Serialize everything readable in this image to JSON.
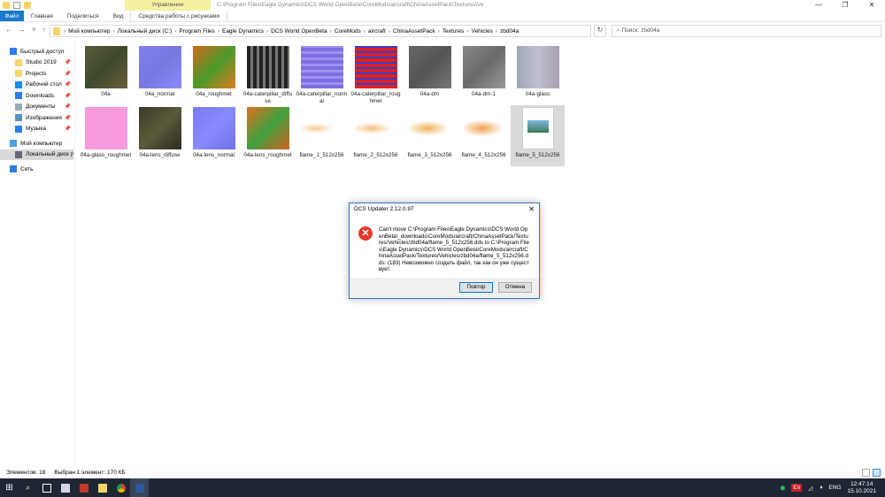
{
  "window": {
    "title": "C:\\Program Files\\Eagle Dynamics\\DCS World OpenBeta\\CoreMods\\aircraft\\ChinaAssetPack\\Textures\\Ve",
    "manage_tab": "Управление",
    "controls": [
      "—",
      "❐",
      "✕"
    ]
  },
  "ribbon": {
    "tabs": [
      "Файл",
      "Главная",
      "Поделиться",
      "Вид"
    ],
    "context_tab": "Средства работы с рисунками"
  },
  "address": {
    "crumbs": [
      "Мой компьютер",
      "Локальный диск (C:)",
      "Program Files",
      "Eagle Dynamics",
      "DCS World OpenBeta",
      "CoreMods",
      "aircraft",
      "ChinaAssetPack",
      "Textures",
      "Vehicles",
      "zbd04a"
    ],
    "search_placeholder": "Поиск: zbd04a"
  },
  "sidebar": {
    "items": [
      {
        "label": "Быстрый доступ",
        "icon": "star-icon",
        "color": "#2b7de9",
        "pin": false,
        "indent": 0
      },
      {
        "label": "Studio 2019",
        "icon": "folder-icon",
        "color": "#f6d36b",
        "pin": true,
        "indent": 1
      },
      {
        "label": "Projects",
        "icon": "folder-icon",
        "color": "#f6d36b",
        "pin": true,
        "indent": 1
      },
      {
        "label": "Рабочий стол",
        "icon": "desktop-icon",
        "color": "#1e88e5",
        "pin": true,
        "indent": 1
      },
      {
        "label": "Downloads",
        "icon": "download-icon",
        "color": "#2b7de9",
        "pin": true,
        "indent": 1
      },
      {
        "label": "Документы",
        "icon": "documents-icon",
        "color": "#9ab",
        "pin": true,
        "indent": 1
      },
      {
        "label": "Изображения",
        "icon": "pictures-icon",
        "color": "#5a8fc0",
        "pin": true,
        "indent": 1
      },
      {
        "label": "Музыка",
        "icon": "music-icon",
        "color": "#2b7de9",
        "pin": true,
        "indent": 1
      },
      {
        "label": "Мой компьютер",
        "icon": "computer-icon",
        "color": "#4aa3e0",
        "pin": false,
        "indent": 0,
        "gap": true
      },
      {
        "label": "Локальный диск (C:)",
        "icon": "drive-icon",
        "color": "#667",
        "pin": false,
        "indent": 1,
        "selected": true
      },
      {
        "label": "Сеть",
        "icon": "network-icon",
        "color": "#2b7de9",
        "pin": false,
        "indent": 0,
        "gap": true
      }
    ]
  },
  "files": [
    {
      "name": "04a",
      "color": "linear-gradient(135deg,#5a5a3a,#3e4a2c,#6b5e3c)"
    },
    {
      "name": "04a_normal",
      "color": "linear-gradient(135deg,#8080f0,#7878e0,#8a8aff)"
    },
    {
      "name": "04a_roughmet",
      "color": "linear-gradient(135deg,#d46a1a,#4a9a2a,#e07a20)"
    },
    {
      "name": "04a-caterpillar_diffuse",
      "color": "repeating-linear-gradient(90deg,#222 0 4px,#777 4px 7px)"
    },
    {
      "name": "04a-caterpillar_normal",
      "color": "repeating-linear-gradient(0deg,#7a70e0 0 4px,#a090f0 4px 7px)"
    },
    {
      "name": "04a-caterpillar_roughmet",
      "color": "repeating-linear-gradient(0deg,#e02020 0 4px,#3040d0 4px 6px)"
    },
    {
      "name": "04a-dm",
      "color": "linear-gradient(135deg,#666,#555,#777)"
    },
    {
      "name": "04a-dm-1",
      "color": "linear-gradient(135deg,#888,#6a6a6a,#999)"
    },
    {
      "name": "04a-glass",
      "color": "linear-gradient(90deg,#9fa7b8,#c0c0d0,#a8a0b0)"
    },
    {
      "name": "04a-glass_roughmet",
      "color": "#f59ade"
    },
    {
      "name": "04a-lens_diffuse",
      "color": "linear-gradient(135deg,#3a3a2a,#5a5a3a,#2a2a20)"
    },
    {
      "name": "04a-lens_normal",
      "color": "linear-gradient(135deg,#7a7af0,#8a8aff,#7070e8)"
    },
    {
      "name": "04a-lens_roughmet",
      "color": "linear-gradient(135deg,#e07020,#40a040,#d06020)"
    },
    {
      "name": "flame_1_512x256",
      "color": "radial-gradient(ellipse 40% 12% at 35% 50%,#f5c890,#fff)"
    },
    {
      "name": "flame_2_512x256",
      "color": "radial-gradient(ellipse 45% 14% at 40% 50%,#f5c080,#fff)"
    },
    {
      "name": "flame_3_512x256",
      "color": "radial-gradient(ellipse 50% 18% at 45% 50%,#f0b060,#fff)"
    },
    {
      "name": "flame_4_512x256",
      "color": "radial-gradient(ellipse 50% 20% at 45% 50%,#eea050,#fff)"
    },
    {
      "name": "flame_5_512x256",
      "color": "generic",
      "selected": true
    }
  ],
  "status": {
    "count": "Элементов: 18",
    "selected": "Выбран 1 элемент: 170 КБ"
  },
  "taskbar": {
    "lang_badge": "En",
    "lang": "ENG",
    "time": "12:47:14",
    "date": "15.10.2021"
  },
  "dialog": {
    "title": "DCS Updater 2.12.0.97",
    "message": "Can't move C:\\Program Files\\Eagle Dynamics\\DCS World OpenBeta\\_downloads\\CoreMods/aircraft/ChinaAssetPack/Textures/Vehicles/zbd04a/flame_5_512x256.dds to C:\\Program Files\\Eagle Dynamics\\DCS World OpenBeta\\CoreMods/aircraft/ChinaAssetPack/Textures/Vehicles/zbd04a/flame_5_512x256.dds: (183) Невозможно создать файл, так как он уже существует.",
    "retry": "Повтор",
    "cancel": "Отмена"
  },
  "colors": {
    "accent": "#0078d7",
    "error": "#e63a2f",
    "taskbar": "#1f2633"
  }
}
